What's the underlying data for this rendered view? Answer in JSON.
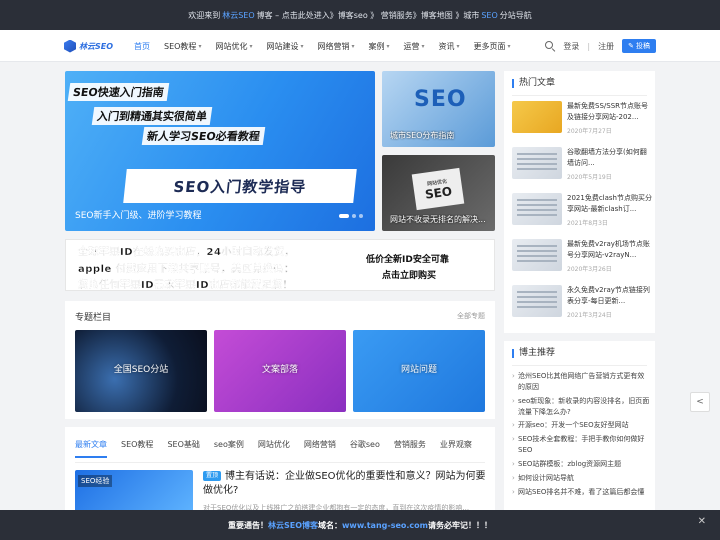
{
  "topbar": {
    "welcome": "欢迎来到",
    "brand": "林云SEO",
    "rest": "博客 – 点击此处进入》博客seo 》 营销服务》博客地图 》城市",
    "city": "SEO",
    "tail": "分站导航"
  },
  "header": {
    "logo_text": "林云SEO",
    "nav": [
      {
        "label": "首页",
        "active": true,
        "dropdown": false
      },
      {
        "label": "SEO教程",
        "dropdown": true
      },
      {
        "label": "网站优化",
        "dropdown": true
      },
      {
        "label": "网站建设",
        "dropdown": true
      },
      {
        "label": "网络营销",
        "dropdown": true
      },
      {
        "label": "案例",
        "dropdown": true
      },
      {
        "label": "运营",
        "dropdown": true
      },
      {
        "label": "资讯",
        "dropdown": true
      },
      {
        "label": "更多页面",
        "dropdown": true
      }
    ],
    "login": "登录",
    "sep": "|",
    "register": "注册",
    "post": "投稿"
  },
  "hero": {
    "lines": [
      "SEO快速入门指南",
      "入门到精通其实很简单",
      "新人学习SEO必看教程"
    ],
    "big": "SEO入门教学指导",
    "caption": "SEO新手入门级、进阶学习教程",
    "side": [
      {
        "caption": "城市SEO分布指南",
        "title": "SEO"
      },
      {
        "caption": "网站不收录无排名的解决...",
        "title": "SEO",
        "sub": "网站优化"
      }
    ]
  },
  "banner": {
    "left": [
      "全球苹果ID在线购买商店，24小时自动发货，",
      "apple 付费应用下载共享账号，美区兑换码：",
      "您的任何苹果ID需求苹果ID商店都能满足您！"
    ],
    "right": [
      "低价全新ID安全可靠",
      "点击立即购买"
    ]
  },
  "topics": {
    "title": "专题栏目",
    "more": "全部专题",
    "items": [
      "全国SEO分站",
      "文案部落",
      "网站问题"
    ]
  },
  "tabs": [
    "最新文章",
    "SEO教程",
    "SEO基础",
    "seo案例",
    "网站优化",
    "网络营销",
    "谷歌seo",
    "营销服务",
    "业界观察"
  ],
  "post": {
    "thumb_label": "SEO经验",
    "badge": "置顶",
    "title": "博主有话说：企业做SEO优化的重要性和意义？网站为何要做优化?",
    "excerpt": "对于SEO优化以及上线推广之前搭建企业都抱有一定的态度，直到在这次疫情的影响..."
  },
  "hot": {
    "title": "热门文章",
    "items": [
      {
        "title": "最新免费SS/SSR节点账号及链接分享网站-202...",
        "date": "2020年7月27日"
      },
      {
        "title": "谷歌翻墙方法分享(如何翻墙访问...",
        "date": "2020年5月19日"
      },
      {
        "title": "2021免费clash节点购买分享网站-最新clash订...",
        "date": "2021年8月3日"
      },
      {
        "title": "最新免费v2ray机场节点账号分享网站-v2rayN...",
        "date": "2020年3月26日"
      },
      {
        "title": "永久免费v2ray节点链接列表分享-每日更新...",
        "date": "2021年3月24日"
      }
    ]
  },
  "recommend": {
    "title": "博主推荐",
    "items": [
      "沧州SEO比其他网络广告营销方式更有效的原因",
      "seo新现象：新收录的内容没排名，旧页面流量下降怎么办?",
      "开源seo：开发一个SEO友好型网站",
      "SEO技术全套教程：手把手教你如何做好SEO",
      "SEO站群模板：zblog资源网主题",
      "如何设计网站导航",
      "网站SEO排名并不难，看了这篇后都会懂"
    ]
  },
  "footer": {
    "pre": "重要通告！",
    "brand": "林云SEO博客",
    "mid": "域名：",
    "domain": "www.tang-seo.com",
    "post": " 请务必牢记！！！"
  },
  "colors": {
    "accent": "#2e7ef0",
    "dark": "#2b2f38"
  }
}
